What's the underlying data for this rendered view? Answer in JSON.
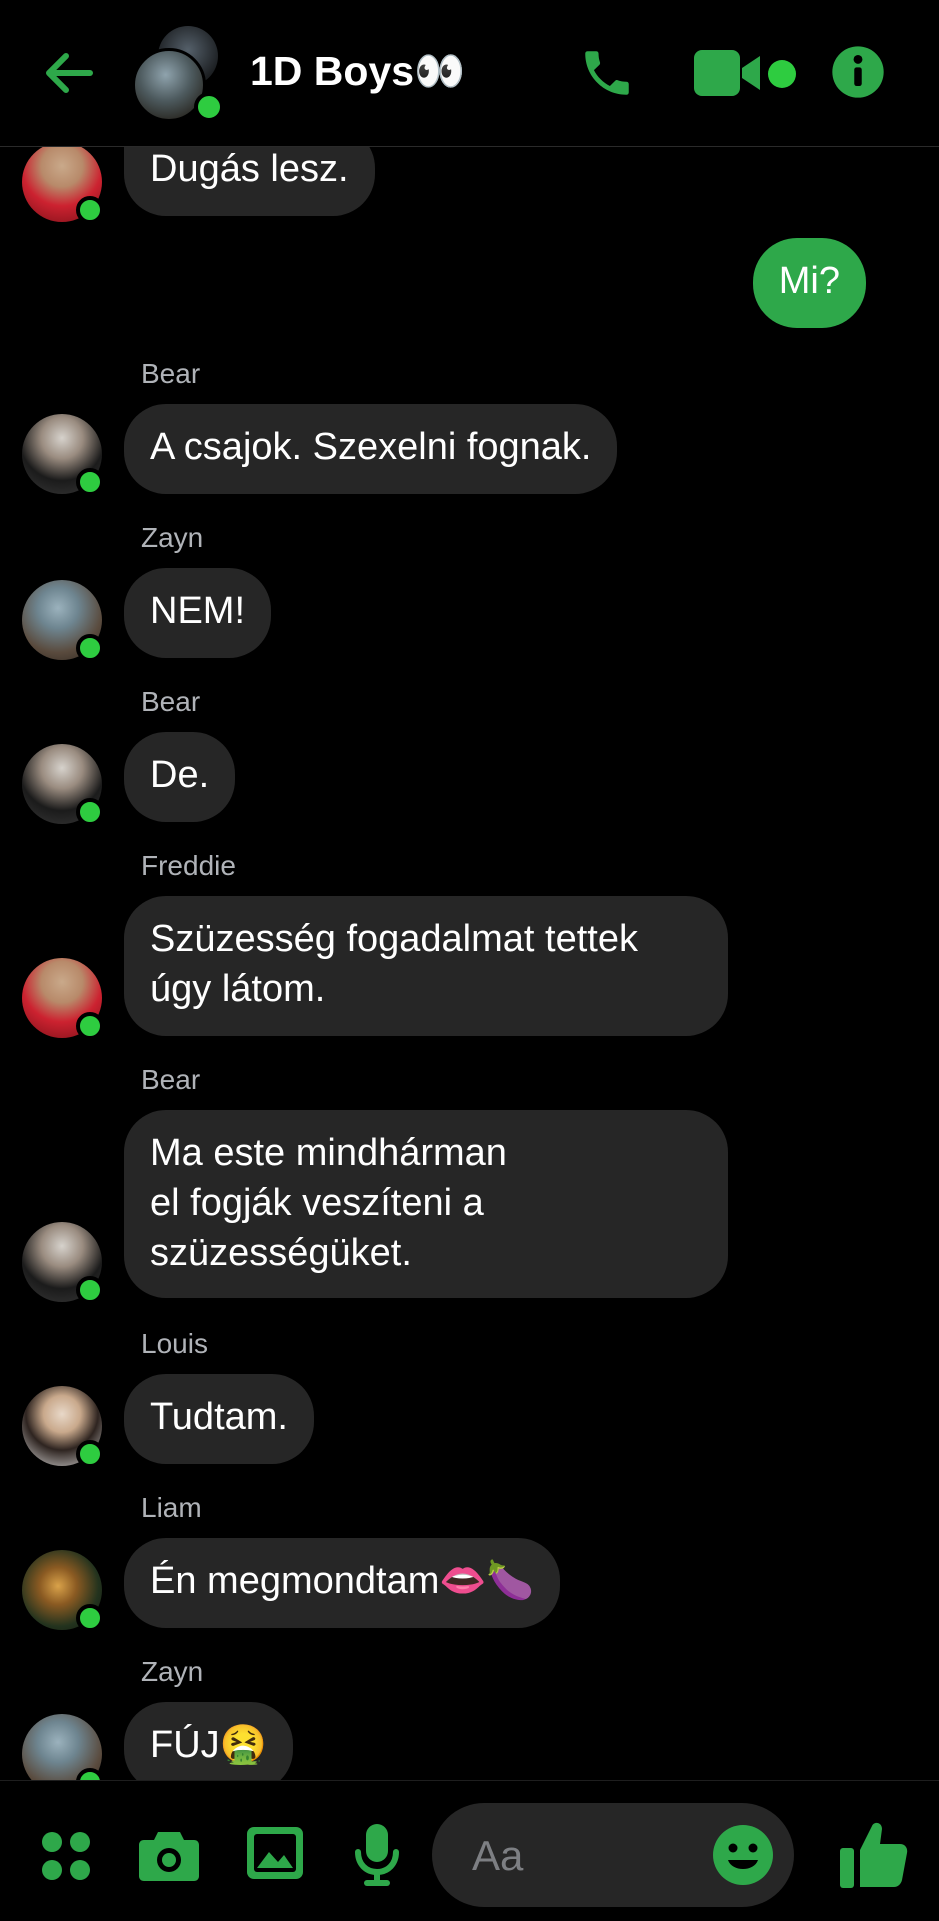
{
  "header": {
    "title": "1D Boys👀",
    "icons": [
      "back-arrow-icon",
      "phone-icon",
      "video-icon",
      "info-icon"
    ],
    "accent_color": "#2ea84a"
  },
  "messages": [
    {
      "type": "in",
      "sender": "",
      "avatar": "freddie",
      "text": "Dugás lesz."
    },
    {
      "type": "out",
      "text": "Mi?"
    },
    {
      "type": "in",
      "sender": "Bear",
      "avatar": "bear",
      "text": "A csajok. Szexelni fognak."
    },
    {
      "type": "in",
      "sender": "Zayn",
      "avatar": "zayn",
      "text": "NEM!"
    },
    {
      "type": "in",
      "sender": "Bear",
      "avatar": "bear",
      "text": "De."
    },
    {
      "type": "in",
      "sender": "Freddie",
      "avatar": "freddie",
      "text": "Szüzesség fogadalmat tettek\núgy látom."
    },
    {
      "type": "in",
      "sender": "Bear",
      "avatar": "bear",
      "text": "Ma este mindhárman\nel fogják veszíteni a\nszüzességüket."
    },
    {
      "type": "in",
      "sender": "Louis",
      "avatar": "louis",
      "text": "Tudtam."
    },
    {
      "type": "in",
      "sender": "Liam",
      "avatar": "liam",
      "text": "Én megmondtam👄🍆"
    },
    {
      "type": "in",
      "sender": "Zayn",
      "avatar": "zayn",
      "text": "FÚJ🤮"
    }
  ],
  "composer": {
    "placeholder": "Aa",
    "icons": [
      "apps-icon",
      "camera-icon",
      "gallery-icon",
      "microphone-icon",
      "emoji-icon",
      "thumbs-up-icon"
    ]
  }
}
